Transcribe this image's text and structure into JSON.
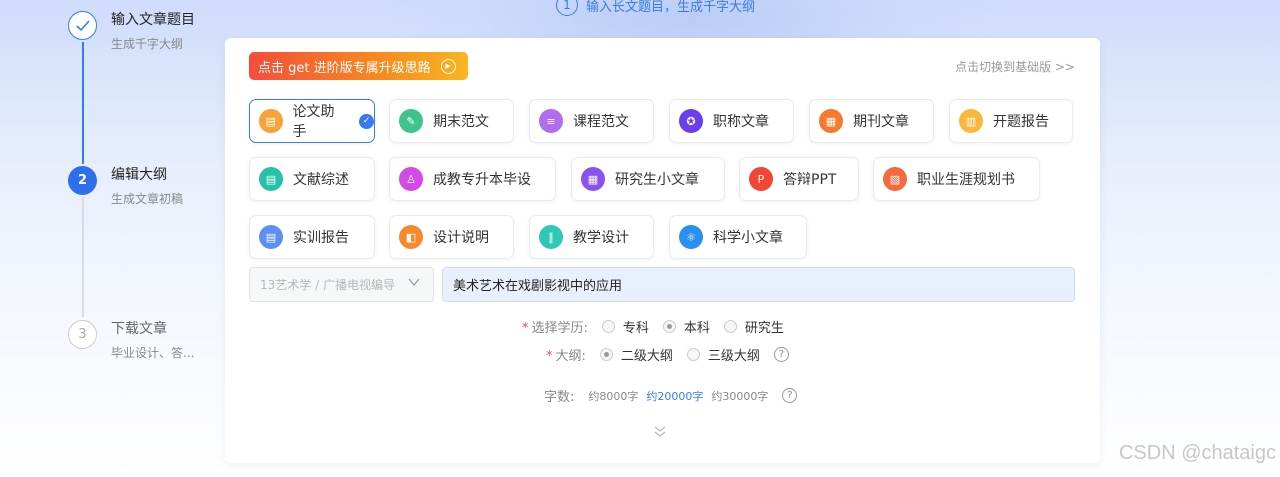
{
  "top_step": {
    "num": "1",
    "label": "输入长文题目，生成千字大纲"
  },
  "steps": [
    {
      "num": "✓",
      "title": "输入文章题目",
      "sub": "生成千字大纲"
    },
    {
      "num": "2",
      "title": "编辑大纲",
      "sub": "生成文章初稿"
    },
    {
      "num": "3",
      "title": "下载文章",
      "sub": "毕业设计、答..."
    }
  ],
  "promo": {
    "label": "点击 get 进阶版专属升级思路"
  },
  "switch_label": "点击切换到基础版 >>",
  "types": [
    {
      "label": "论文助手",
      "icon": "book-icon",
      "color": "#f7a33a",
      "active": true
    },
    {
      "label": "期末范文",
      "icon": "pen-icon",
      "color": "#3ec48a"
    },
    {
      "label": "课程范文",
      "icon": "layers-icon",
      "color": "#b06df0"
    },
    {
      "label": "职称文章",
      "icon": "certificate-icon",
      "color": "#6a3df0"
    },
    {
      "label": "期刊文章",
      "icon": "journal-icon",
      "color": "#f5792e"
    },
    {
      "label": "开题报告",
      "icon": "report-icon",
      "color": "#f9b73c"
    },
    {
      "label": "文献综述",
      "icon": "document-icon",
      "color": "#26c2a8"
    },
    {
      "label": "成教专升本毕设",
      "icon": "graduate-icon",
      "color": "#d34ae8"
    },
    {
      "label": "研究生小文章",
      "icon": "notes-icon",
      "color": "#8a53ef"
    },
    {
      "label": "答辩PPT",
      "icon": "ppt-icon",
      "color": "#f24533"
    },
    {
      "label": "职业生涯规划书",
      "icon": "plan-icon",
      "color": "#f46a3c"
    },
    {
      "label": "实训报告",
      "icon": "training-icon",
      "color": "#5d8ff2"
    },
    {
      "label": "设计说明",
      "icon": "design-icon",
      "color": "#f7892c"
    },
    {
      "label": "教学设计",
      "icon": "teaching-icon",
      "color": "#2ec8b5"
    },
    {
      "label": "科学小文章",
      "icon": "atom-icon",
      "color": "#2a8ff0"
    }
  ],
  "major": {
    "placeholder": "13艺术学 / 广播电视编导"
  },
  "topic": {
    "value": "美术艺术在戏剧影视中的应用"
  },
  "education": {
    "label": "选择学历:",
    "options": [
      "专科",
      "本科",
      "研究生"
    ],
    "selected": "本科"
  },
  "outline": {
    "label": "大纲:",
    "options": [
      "二级大纲",
      "三级大纲"
    ],
    "selected": "二级大纲"
  },
  "wordcount": {
    "label": "字数:",
    "options": [
      "约8000字",
      "约20000字",
      "约30000字"
    ],
    "selected": "约20000字"
  },
  "watermark": "CSDN @chataigc"
}
